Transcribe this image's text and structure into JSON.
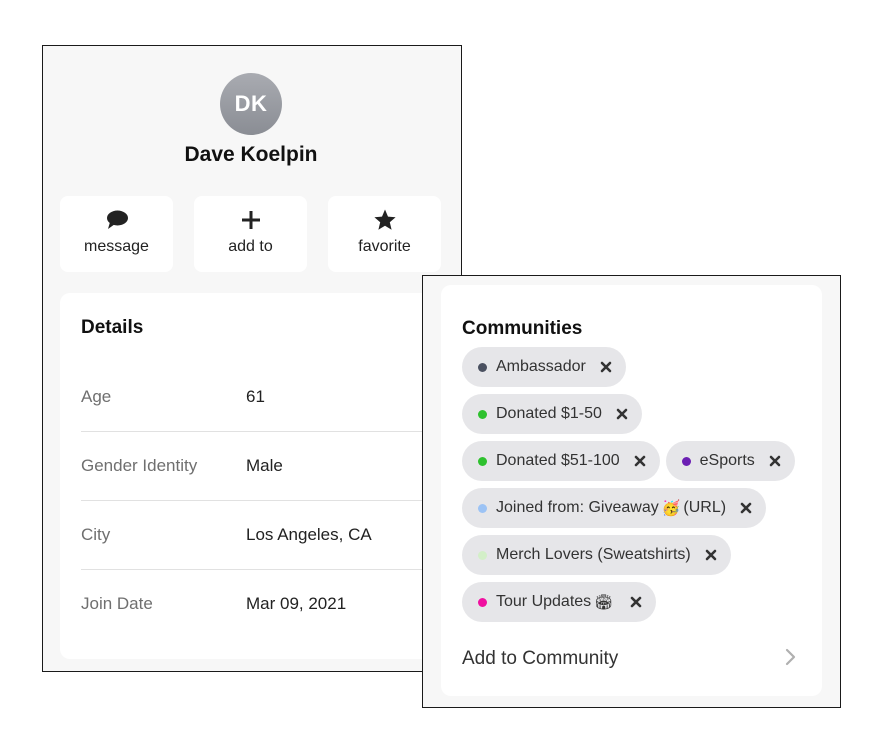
{
  "profile": {
    "initials": "DK",
    "name": "Dave Koelpin",
    "actions": [
      {
        "label": "message",
        "icon": "chat-bubble-icon"
      },
      {
        "label": "add to",
        "icon": "plus-icon"
      },
      {
        "label": "favorite",
        "icon": "star-icon"
      }
    ]
  },
  "details": {
    "title": "Details",
    "rows": [
      {
        "label": "Age",
        "value": "61"
      },
      {
        "label": "Gender Identity",
        "value": "Male"
      },
      {
        "label": "City",
        "value": "Los Angeles, CA"
      },
      {
        "label": "Join Date",
        "value": "Mar 09, 2021"
      }
    ]
  },
  "communities": {
    "title": "Communities",
    "chips": [
      {
        "name": "Ambassador",
        "dot_color": "#4a5060"
      },
      {
        "name": "Donated $1-50",
        "dot_color": "#2ec12e"
      },
      {
        "name": "Donated $51-100",
        "dot_color": "#2ec12e"
      },
      {
        "name": "eSports",
        "dot_color": "#6b1fb3"
      },
      {
        "name": "Joined from: Giveaway",
        "emoji": "🥳",
        "suffix": "(URL)",
        "dot_color": "#9cc3f5"
      },
      {
        "name": "Merch Lovers (Sweatshirts)",
        "dot_color": "#d3efc8"
      },
      {
        "name": "Tour Updates",
        "emoji": "🏟",
        "dot_color": "#f010a0"
      }
    ],
    "add_label": "Add to Community"
  },
  "colors": {
    "panel_bg": "#f7f7f7",
    "card_bg": "#ffffff",
    "chip_bg": "#e6e6e9",
    "label_gray": "#6f6f6f"
  }
}
